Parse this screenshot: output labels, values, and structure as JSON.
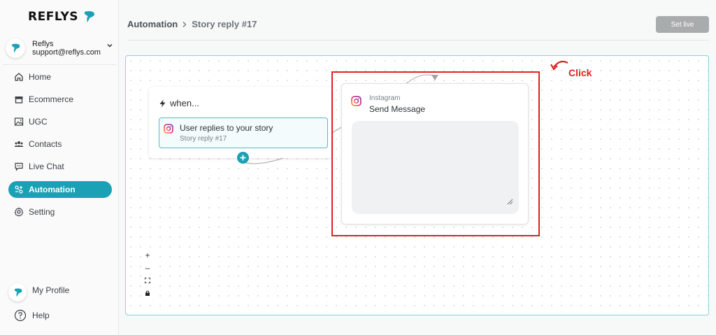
{
  "brand": {
    "name": "REFLYS",
    "accent": "#1aa1b5"
  },
  "account": {
    "name": "Reflys",
    "email": "support@reflys.com",
    "caret_icon": "chevron-down-icon"
  },
  "sidebar": {
    "items": [
      {
        "label": "Home",
        "icon": "home-icon",
        "active": false
      },
      {
        "label": "Ecommerce",
        "icon": "store-icon",
        "active": false
      },
      {
        "label": "UGC",
        "icon": "image-icon",
        "active": false
      },
      {
        "label": "Contacts",
        "icon": "users-icon",
        "active": false
      },
      {
        "label": "Live Chat",
        "icon": "chat-icon",
        "active": false
      },
      {
        "label": "Automation",
        "icon": "automation-icon",
        "active": true
      },
      {
        "label": "Setting",
        "icon": "gear-icon",
        "active": false
      }
    ],
    "profile_label": "My Profile",
    "help_label": "Help"
  },
  "header": {
    "breadcrumb": [
      "Automation",
      "Story reply #17"
    ],
    "set_live_label": "Set live"
  },
  "canvas": {
    "when_card": {
      "title": "when...",
      "trigger_title": "User replies to your story",
      "trigger_subtitle": "Story reply #17"
    },
    "message_card": {
      "provider": "Instagram",
      "title": "Send Message",
      "message_value": ""
    },
    "zoom_controls": [
      "+",
      "–"
    ]
  },
  "annotation": {
    "label": "Click",
    "color": "#e02020"
  }
}
